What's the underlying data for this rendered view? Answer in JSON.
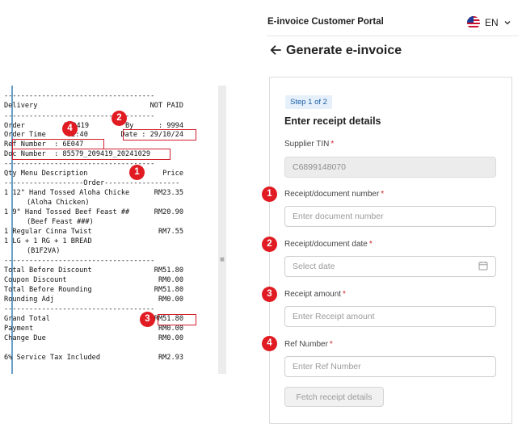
{
  "receipt": {
    "dash_line": "------------------------------------",
    "delivery": "Delivery",
    "not_paid": "NOT PAID",
    "order_label": "Order",
    "order_value": "209419",
    "by_label": "By",
    "by_value": ": 9994",
    "order_time_label": "Order Time",
    "order_time_value": "02:40",
    "date_text": "Date : 29/10/24",
    "ref_number": "Ref Number  : 6E047",
    "doc_number": "Doc Number  : 85579_209419_20241029",
    "col_header_left": "Qty Menu Description",
    "col_header_right": "Price",
    "order_divider": "-------------------Order------------------",
    "items": [
      {
        "line1": "1 12\" Hand Tossed Aloha Chicke",
        "price": "RM23.35",
        "line2": "(Aloha Chicken)"
      },
      {
        "line1": "1 9\" Hand Tossed Beef Feast ##",
        "price": "RM20.90",
        "line2": "(Beef Feast ###)"
      },
      {
        "line1": "1 Regular Cinna Twist",
        "price": "RM7.55",
        "line2": ""
      },
      {
        "line1": "1 LG + 1 RG + 1 BREAD",
        "price": "",
        "line2": "(B1F2VA)"
      }
    ],
    "totals": [
      {
        "label": "Total Before Discount",
        "value": "RM51.80"
      },
      {
        "label": "Coupon Discount",
        "value": "RM0.00"
      },
      {
        "label": "Total Before Rounding",
        "value": "RM51.80"
      },
      {
        "label": "Rounding Adj",
        "value": "RM0.00"
      }
    ],
    "grand_total_label": "Grand Total",
    "grand_total_value": "RM51.80",
    "payment_label": "Payment",
    "payment_value": "RM0.00",
    "change_label": "Change Due",
    "change_value": "RM0.00",
    "tax_label": "6% Service Tax Included",
    "tax_value": "RM2.93",
    "scroll_grip": "≡"
  },
  "badges": [
    "1",
    "2",
    "3",
    "4"
  ],
  "portal": {
    "title": "E-invoice Customer Portal",
    "language": "EN",
    "flag_icon": "us-flag-icon",
    "page_title": "Generate e-invoice",
    "step": "Step 1 of 2",
    "section_title": "Enter receipt details",
    "supplier_tin_label": "Supplier TIN",
    "supplier_tin_value": "C6899148070",
    "receipt_number_label": "Receipt/document number",
    "receipt_number_placeholder": "Enter document number",
    "receipt_date_label": "Receipt/document date",
    "receipt_date_placeholder": "Select date",
    "amount_label": "Receipt amount",
    "amount_placeholder": "Enter Receipt amount",
    "ref_label": "Ref Number",
    "ref_placeholder": "Enter Ref Number",
    "required_mark": "*",
    "fetch_button": "Fetch receipt details"
  },
  "colors": {
    "accent_red": "#e11b22",
    "step_blue": "#1b5fa8"
  }
}
